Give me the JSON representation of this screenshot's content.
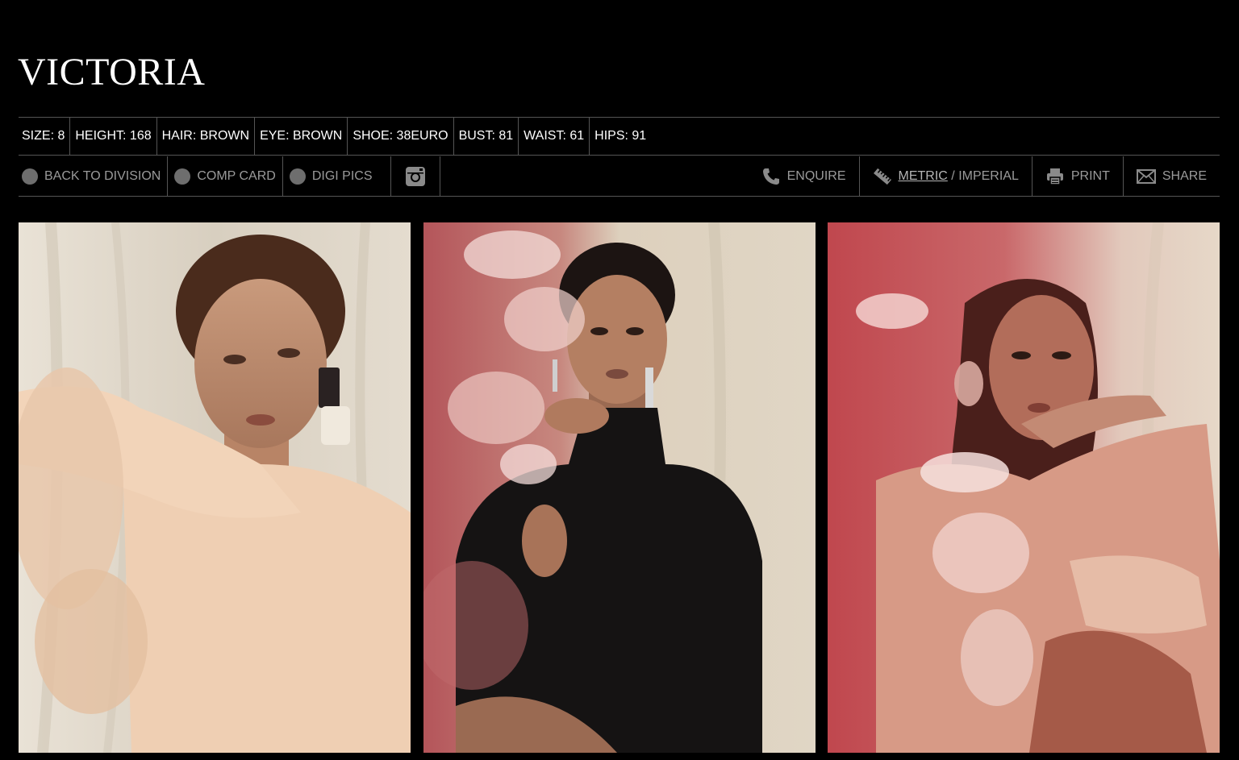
{
  "model": {
    "name": "VICTORIA"
  },
  "stats": [
    {
      "label": "SIZE: 8"
    },
    {
      "label": "HEIGHT: 168"
    },
    {
      "label": "HAIR: BROWN"
    },
    {
      "label": "EYE: BROWN"
    },
    {
      "label": "SHOE: 38EURO"
    },
    {
      "label": "BUST: 81"
    },
    {
      "label": "WAIST: 61"
    },
    {
      "label": "HIPS: 91"
    }
  ],
  "actions": {
    "back": "BACK TO DIVISION",
    "comp_card": "COMP CARD",
    "digi_pics": "DIGI PICS",
    "enquire": "ENQUIRE",
    "metric": "METRIC",
    "unit_sep": " / ",
    "imperial": "IMPERIAL",
    "print": "PRINT",
    "share": "SHARE"
  },
  "icons": {
    "instagram": "instagram-icon",
    "phone": "phone-icon",
    "ruler": "ruler-icon",
    "print": "printer-icon",
    "share": "envelope-icon"
  },
  "colors": {
    "background": "#000000",
    "text": "#ffffff",
    "muted": "#9a9a9a",
    "divider": "#555555"
  }
}
